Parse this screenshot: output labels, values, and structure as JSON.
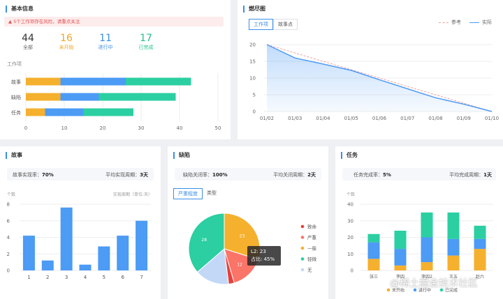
{
  "basic": {
    "title": "基本信息",
    "alert": "5个工作项存在风险，请重点关注",
    "stats": [
      {
        "value": "44",
        "label": "全部",
        "color": "#333333"
      },
      {
        "value": "16",
        "label": "未开始",
        "color": "#f5a623"
      },
      {
        "value": "11",
        "label": "进行中",
        "color": "#3a8ee6"
      },
      {
        "value": "17",
        "label": "已完成",
        "color": "#22c08f"
      }
    ],
    "chart_ylabel": "工作项"
  },
  "burndown": {
    "title": "燃尽图",
    "tabs": [
      "工作项",
      "故事点"
    ],
    "legend": {
      "reference": "参考",
      "actual": "实际"
    }
  },
  "story": {
    "title": "故事",
    "summary": {
      "rate_label": "故事实现率：",
      "rate_value": "70%",
      "cycle_label": "平均实现周期：",
      "cycle_value": "3天"
    },
    "y_caption": "个数",
    "right_caption": "实现周期（单位:天）"
  },
  "defect": {
    "title": "缺陷",
    "summary": {
      "rate_label": "缺陷关闭率：",
      "rate_value": "100%",
      "cycle_label": "平均关闭周期：",
      "cycle_value": "2天"
    },
    "tabs": [
      "严重程度",
      "类型"
    ],
    "tooltip": {
      "line1": "L2: 23",
      "line2": "占比: 45%"
    }
  },
  "task": {
    "title": "任务",
    "summary": {
      "rate_label": "任务完成率：",
      "rate_value": "5%",
      "cycle_label": "平均完成周期：",
      "cycle_value": "1天"
    },
    "y_caption": "个数"
  },
  "watermark": "@稀土掘金技术社区",
  "colors": {
    "blue": "#4c9bf5",
    "yellow": "#f5b02e",
    "green": "#2bcfa1",
    "red": "#e8403a",
    "salmon": "#fa7468",
    "lightblue": "#c3d8f7"
  },
  "chart_data": [
    {
      "type": "bar",
      "orientation": "horizontal",
      "stacked": true,
      "ylabel": "工作项",
      "categories": [
        "故事",
        "缺陷",
        "任务"
      ],
      "series": [
        {
          "name": "未开始",
          "color": "#f5b02e",
          "values": [
            9,
            9,
            5
          ]
        },
        {
          "name": "进行中",
          "color": "#4c9bf5",
          "values": [
            17,
            10,
            10
          ]
        },
        {
          "name": "已完成",
          "color": "#2bcfa1",
          "values": [
            17,
            20,
            13
          ]
        }
      ],
      "xlim": [
        0,
        50
      ],
      "xticks": [
        "0",
        "10",
        "20",
        "30",
        "40",
        "50"
      ]
    },
    {
      "type": "line",
      "x": [
        "01/02",
        "01/03",
        "01/04",
        "01/05",
        "01/06",
        "01/07",
        "01/08",
        "01/09",
        "01/10"
      ],
      "series": [
        {
          "name": "参考",
          "values": [
            20,
            17.5,
            15,
            12.5,
            10,
            7.5,
            5,
            2.5,
            0
          ]
        },
        {
          "name": "实际",
          "values": [
            20,
            16,
            14.2,
            12.3,
            9.5,
            6.8,
            4.1,
            2.2,
            0
          ]
        }
      ],
      "ylim": [
        0,
        20
      ],
      "yticks": [
        "0",
        "5",
        "10",
        "15",
        "20"
      ]
    },
    {
      "type": "bar",
      "categories": [
        "1",
        "2",
        "3",
        "4",
        "5",
        "6",
        "7"
      ],
      "values": [
        4.2,
        1.2,
        7.6,
        0.7,
        2.9,
        4.2,
        6
      ],
      "ylim": [
        0,
        8
      ],
      "yticks": [
        "0",
        "2",
        "4",
        "6",
        "8"
      ],
      "ylabel": "个数",
      "xlabel": "实现周期（单位:天）"
    },
    {
      "type": "pie",
      "labels": [
        "致命",
        "严重",
        "一般",
        "轻微",
        "无"
      ],
      "colors": [
        "#e8403a",
        "#fa7468",
        "#f5b02e",
        "#2bcfa1",
        "#c3d8f7"
      ],
      "values": [
        2,
        12,
        23,
        28,
        12
      ],
      "slice_labels": [
        "",
        "12",
        "23",
        "28",
        ""
      ]
    },
    {
      "type": "bar",
      "stacked": true,
      "ylabel": "个数",
      "categories": [
        "张三",
        "李四",
        "李四2",
        "王五",
        "赵六"
      ],
      "series": [
        {
          "name": "未开始",
          "color": "#f5b02e",
          "values": [
            7,
            3,
            5,
            9,
            13
          ]
        },
        {
          "name": "进行中",
          "color": "#4c9bf5",
          "values": [
            10,
            10,
            15,
            10,
            6
          ]
        },
        {
          "name": "已完成",
          "color": "#2bcfa1",
          "values": [
            5,
            11,
            15,
            16,
            8
          ]
        }
      ],
      "ylim": [
        0,
        40
      ],
      "yticks": [
        "0",
        "10",
        "20",
        "30",
        "40"
      ]
    }
  ]
}
